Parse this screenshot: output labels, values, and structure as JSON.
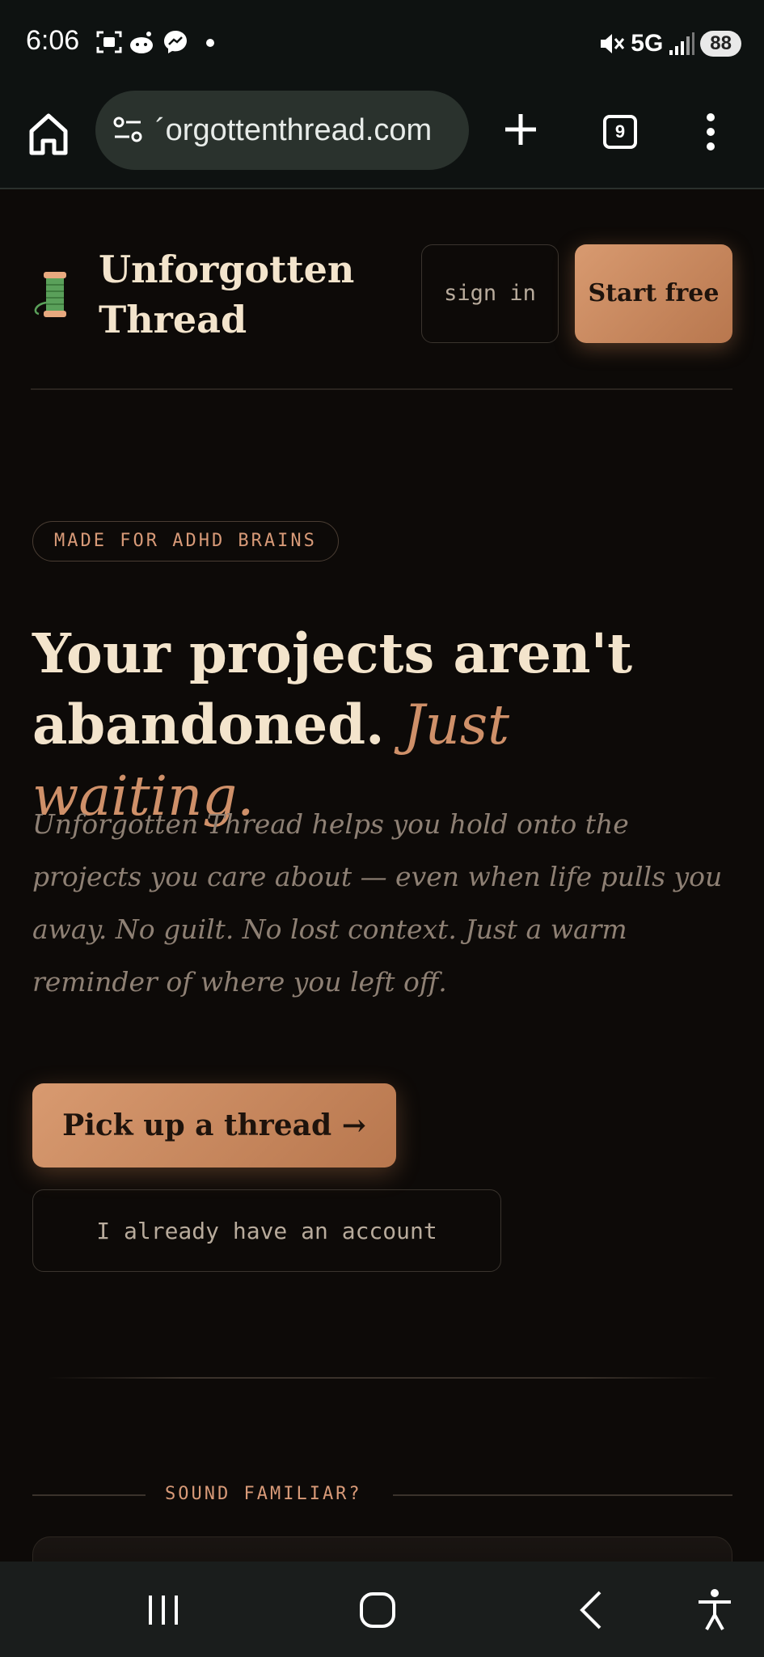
{
  "status_bar": {
    "time": "6:06",
    "network": "5G",
    "battery": "88",
    "icons": [
      "screenshot-icon",
      "reddit-icon",
      "messenger-icon",
      "notification-dot-icon",
      "mute-icon",
      "signal-icon"
    ]
  },
  "browser": {
    "url": "´orgottenthread.com",
    "tab_count": "9"
  },
  "header": {
    "brand_name": "Unforgotten Thread",
    "signin_label": "sign in",
    "start_label": "Start free"
  },
  "hero": {
    "badge": "MADE FOR ADHD BRAINS",
    "headline_main": "Your projects aren't abandoned.",
    "headline_accent": "Just waiting.",
    "subtext": "Unforgotten Thread helps you hold onto the projects you care about — even when life pulls you away. No guilt. No lost context. Just a warm reminder of where you left off.",
    "cta_primary": "Pick up a thread →",
    "cta_secondary": "I already have an account"
  },
  "section": {
    "familiar_label": "SOUND FAMILIAR?"
  },
  "colors": {
    "background": "#0d0a08",
    "accent": "#cf9069",
    "text": "#f3e4cc"
  }
}
